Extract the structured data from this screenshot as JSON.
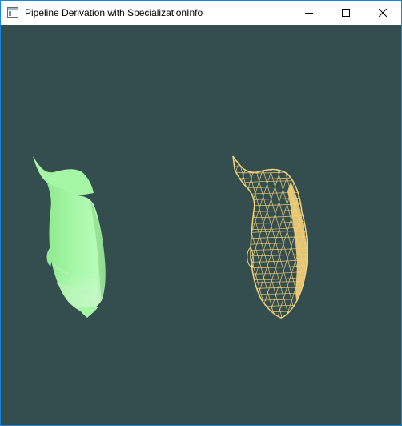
{
  "window": {
    "title": "Pipeline Derivation with SpecializationInfo",
    "accent_border": "#1a87d6"
  },
  "caption_buttons": {
    "minimize_icon": "minimize-icon",
    "maximize_icon": "maximize-icon",
    "close_icon": "close-icon"
  },
  "viewport": {
    "clear_color": "#344e4f",
    "models": [
      {
        "name": "phong-shaded-model",
        "style": "solid",
        "color": "#a5f7a5"
      },
      {
        "name": "wireframe-model",
        "style": "wireframe",
        "color": "#f4d27a"
      }
    ]
  }
}
